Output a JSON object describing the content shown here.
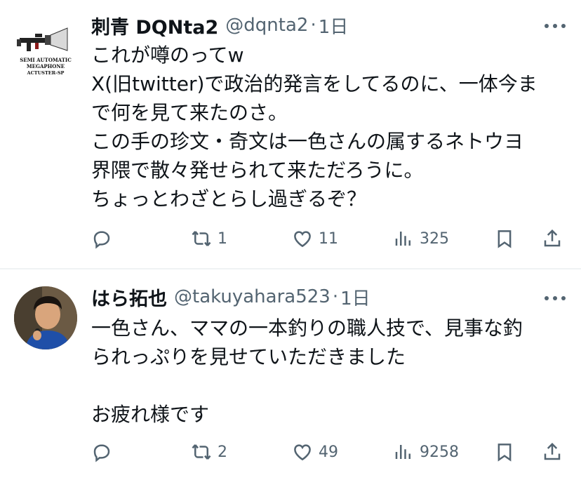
{
  "posts": [
    {
      "name": "刺青 DQNta2",
      "handle": "@dqnta2",
      "separator": "·",
      "time": "1日",
      "avatar_text": [
        "SEMI AUTOMATIC",
        "MEGAPHONE",
        "ACTUSTER-SP"
      ],
      "lines": [
        "これが噂のってw",
        "X(旧twitter)で政治的発言をしてるのに、一体今ま",
        "で何を見て来たのさ。",
        "この手の珍文・奇文は一色さんの属するネトウヨ",
        "界隈で散々発せられて来ただろうに。",
        "ちょっとわざとらし過ぎるぞ？"
      ],
      "reposts": "1",
      "likes": "11",
      "views": "325"
    },
    {
      "name": "はら拓也",
      "handle": "@takuyahara523",
      "separator": "·",
      "time": "1日",
      "lines": [
        "一色さん、ママの一本釣りの職人技で、見事な釣",
        "られっぷりを見せていただきました",
        "",
        "お疲れ様です"
      ],
      "reposts": "2",
      "likes": "49",
      "views": "9258"
    }
  ],
  "colors": {
    "text": "#0f1419",
    "secondary": "#536471",
    "divider": "#eff3f4"
  }
}
